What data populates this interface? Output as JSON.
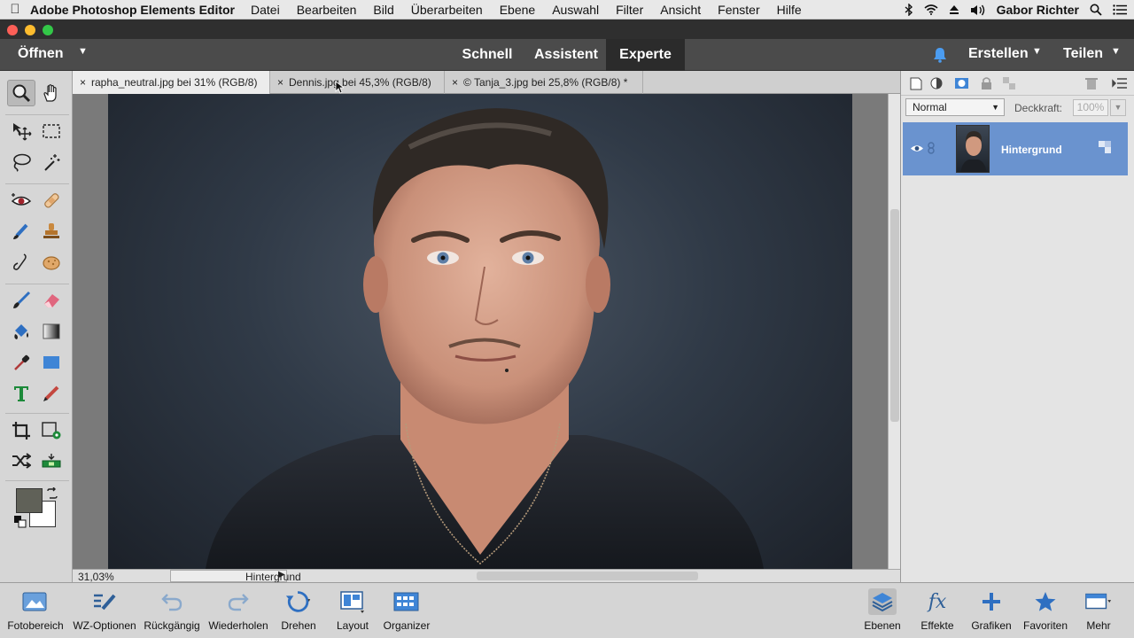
{
  "menubar": {
    "app_name": "Adobe Photoshop Elements Editor",
    "items": [
      "Datei",
      "Bearbeiten",
      "Bild",
      "Überarbeiten",
      "Ebene",
      "Auswahl",
      "Filter",
      "Ansicht",
      "Fenster",
      "Hilfe"
    ],
    "user": "Gabor Richter"
  },
  "modebar": {
    "open_label": "Öffnen",
    "modes": [
      "Schnell",
      "Assistent",
      "Experte"
    ],
    "active_mode": "Experte",
    "create_label": "Erstellen",
    "share_label": "Teilen"
  },
  "tabs": [
    {
      "label": "rapha_neutral.jpg bei 31% (RGB/8)",
      "active": true
    },
    {
      "label": "Dennis.jpg bei 45,3% (RGB/8)",
      "active": false
    },
    {
      "label": "© Tanja_3.jpg bei 25,8% (RGB/8) *",
      "active": false
    }
  ],
  "status": {
    "zoom": "31,03%",
    "layer": "Hintergrund"
  },
  "layers_panel": {
    "blend_mode": "Normal",
    "opacity_label": "Deckkraft:",
    "opacity_value": "100%",
    "layers": [
      {
        "name": "Hintergrund",
        "selected": true
      }
    ]
  },
  "bottombar": {
    "photo_bin": "Fotobereich",
    "tool_options": "WZ-Optionen",
    "undo": "Rückgängig",
    "redo": "Wiederholen",
    "rotate": "Drehen",
    "layout": "Layout",
    "organizer": "Organizer",
    "layers": "Ebenen",
    "effects": "Effekte",
    "graphics": "Grafiken",
    "favorites": "Favoriten",
    "more": "Mehr"
  },
  "colors": {
    "accent_blue": "#6a93cf",
    "foreground_swatch": "#606158",
    "background_swatch": "#ffffff"
  }
}
